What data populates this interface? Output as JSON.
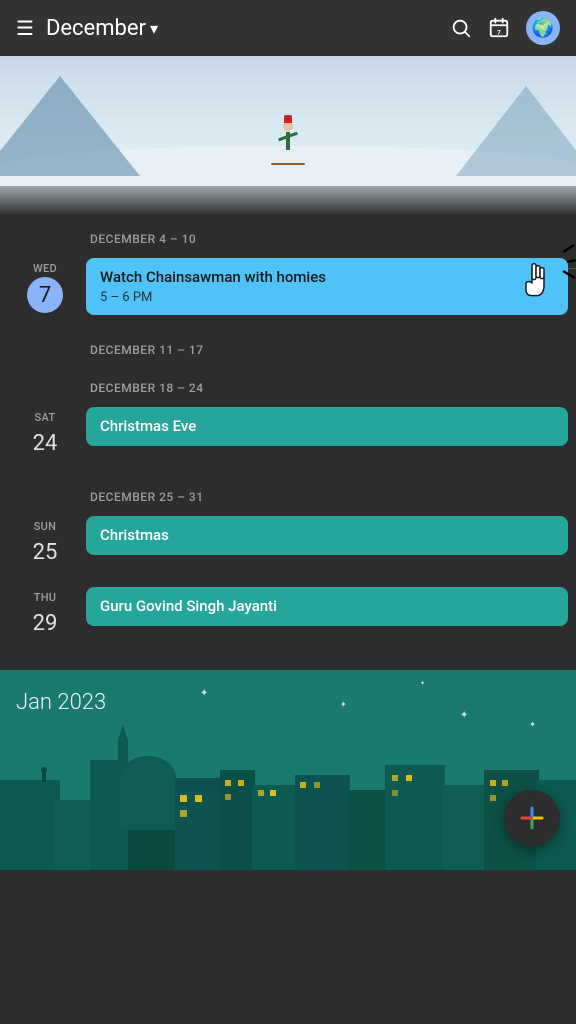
{
  "header": {
    "menu_label": "☰",
    "title": "December",
    "dropdown_char": "▾",
    "search_label": "search",
    "calendar_label": "calendar",
    "avatar_emoji": "🌍"
  },
  "weeks": [
    {
      "id": "week1",
      "label": "DECEMBER 4 – 10",
      "days": [
        {
          "day_name": "WED",
          "day_number": "7",
          "is_today": true,
          "has_dot": true,
          "event": {
            "title": "Watch Chainsawman with homies",
            "time": "5 – 6 PM",
            "color": "blue",
            "has_cursor": true
          }
        }
      ]
    },
    {
      "id": "week2",
      "label": "DECEMBER 11 – 17",
      "days": []
    },
    {
      "id": "week3",
      "label": "DECEMBER 18 – 24",
      "days": [
        {
          "day_name": "SAT",
          "day_number": "24",
          "is_today": false,
          "has_dot": false,
          "event": {
            "title": "Christmas Eve",
            "time": "",
            "color": "teal",
            "has_cursor": false
          }
        }
      ]
    },
    {
      "id": "week4",
      "label": "DECEMBER 25 – 31",
      "days": [
        {
          "day_name": "SUN",
          "day_number": "25",
          "is_today": false,
          "has_dot": false,
          "event": {
            "title": "Christmas",
            "time": "",
            "color": "teal",
            "has_cursor": false
          }
        },
        {
          "day_name": "THU",
          "day_number": "29",
          "is_today": false,
          "has_dot": false,
          "event": {
            "title": "Guru Govind Singh Jayanti",
            "time": "",
            "color": "teal",
            "has_cursor": false
          }
        }
      ]
    }
  ],
  "bottom": {
    "month_label": "Jan 2023"
  },
  "fab": {
    "label": "+"
  }
}
